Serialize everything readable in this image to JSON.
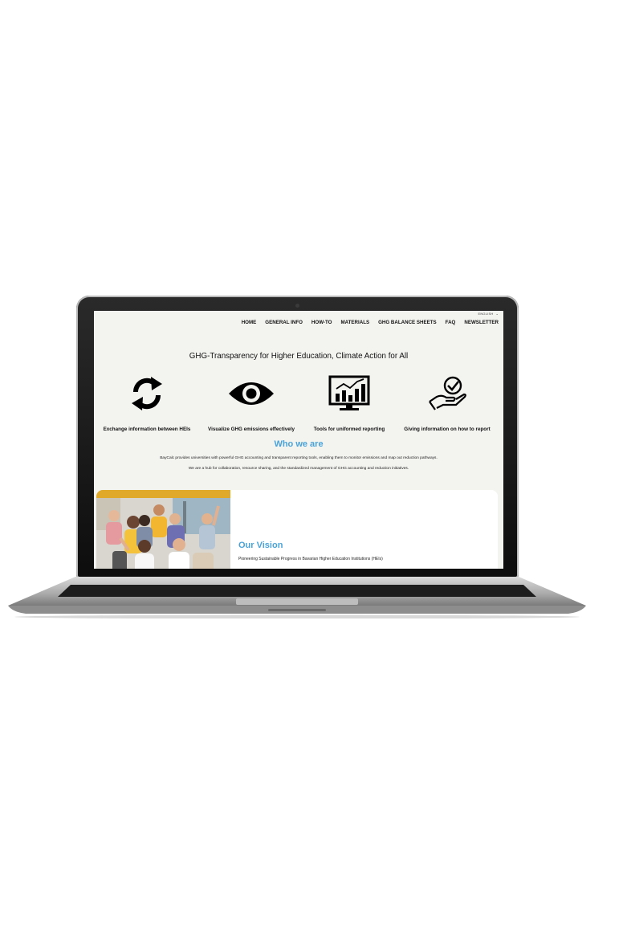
{
  "site": {
    "language": "ENGLISH",
    "nav": [
      "HOME",
      "GENERAL INFO",
      "HOW-TO",
      "MATERIALS",
      "GHG BALANCE SHEETS",
      "FAQ",
      "NEWSLETTER"
    ],
    "hero_title": "GHG-Transparency for Higher Education, Climate Action for All",
    "features": [
      {
        "icon": "sync-arrows-icon",
        "label": "Exchange information between HEIs"
      },
      {
        "icon": "eye-icon",
        "label": "Visualize GHG emissions effectively"
      },
      {
        "icon": "chart-monitor-icon",
        "label": "Tools for uniformed reporting"
      },
      {
        "icon": "hand-check-icon",
        "label": "Giving information on how to report"
      }
    ],
    "who_title": "Who we are",
    "who_lines": [
      "BayCalc provides universities with powerful GHG accounting and transparent reporting tools, enabling them to monitor emissions and map out reduction pathways.",
      "We are a hub for collaboration, resource sharing, and the standardized management of GHG accounting and reduction initiatives."
    ],
    "vision_title": "Our Vision",
    "vision_sub": "Pioneering Sustainable Progress in Bavarian Higher Education Institutions (HEIs)"
  },
  "colors": {
    "accent": "#4aa3d8",
    "page_bg": "#f3f3f0"
  }
}
